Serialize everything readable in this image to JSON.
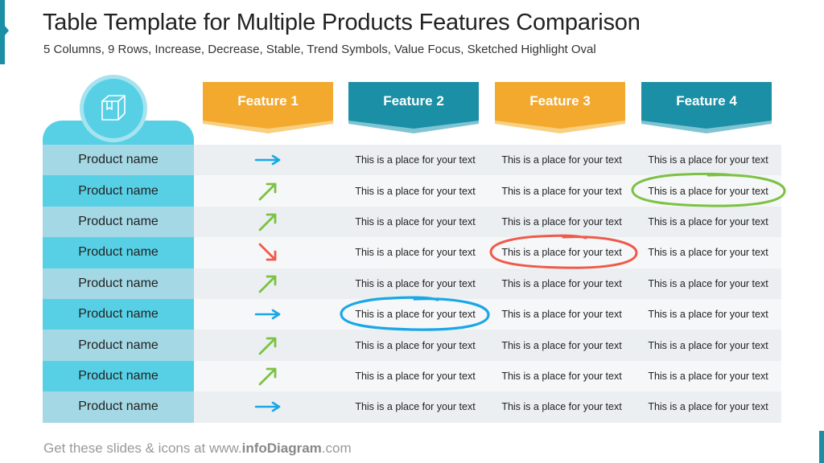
{
  "slide": {
    "title": "Table Template for Multiple Products Features Comparison",
    "subtitle": "5 Columns, 9 Rows, Increase, Decrease, Stable, Trend Symbols, Value Focus, Sketched Highlight Oval"
  },
  "header": {
    "product_icon": "box-icon",
    "features": [
      {
        "label": "Feature 1",
        "color": "#f2a92e"
      },
      {
        "label": "Feature 2",
        "color": "#1a8fa5"
      },
      {
        "label": "Feature 3",
        "color": "#f2a92e"
      },
      {
        "label": "Feature 4",
        "color": "#1a8fa5"
      }
    ]
  },
  "colors": {
    "increase": "#7cc242",
    "decrease": "#ef5a4a",
    "stable": "#1aa7e6",
    "product_light": "#a3d8e4",
    "product_dark": "#57d0e6",
    "row_light": "#eceff2",
    "row_dark": "#f6f7f9",
    "highlight_green": "#7cc242",
    "highlight_red": "#ef5a4a",
    "highlight_blue": "#1aa7e6"
  },
  "rows": [
    {
      "product": "Product name",
      "trend": "stable",
      "cells": [
        "This is a place for your text",
        "This is a place for your text",
        "This is a place for your text"
      ]
    },
    {
      "product": "Product name",
      "trend": "increase",
      "cells": [
        "This is a place for your text",
        "This is a place for your text",
        "This is a place for your text"
      ]
    },
    {
      "product": "Product name",
      "trend": "increase",
      "cells": [
        "This is a place for your text",
        "This is a place for your text",
        "This is a place for your text"
      ]
    },
    {
      "product": "Product name",
      "trend": "decrease",
      "cells": [
        "This is a place for your text",
        "This is a place for your text",
        "This is a place for your text"
      ]
    },
    {
      "product": "Product name",
      "trend": "increase",
      "cells": [
        "This is a place for your text",
        "This is a place for your text",
        "This is a place for your text"
      ]
    },
    {
      "product": "Product name",
      "trend": "stable",
      "cells": [
        "This is a place for your text",
        "This is a place for your text",
        "This is a place for your text"
      ]
    },
    {
      "product": "Product name",
      "trend": "increase",
      "cells": [
        "This is a place for your text",
        "This is a place for your text",
        "This is a place for your text"
      ]
    },
    {
      "product": "Product name",
      "trend": "increase",
      "cells": [
        "This is a place for your text",
        "This is a place for your text",
        "This is a place for your text"
      ]
    },
    {
      "product": "Product name",
      "trend": "stable",
      "cells": [
        "This is a place for your text",
        "This is a place for your text",
        "This is a place for your text"
      ]
    }
  ],
  "highlights": [
    {
      "row": 2,
      "column": "Feature 4",
      "color": "green"
    },
    {
      "row": 4,
      "column": "Feature 3",
      "color": "red"
    },
    {
      "row": 6,
      "column": "Feature 2",
      "color": "blue"
    }
  ],
  "footer": {
    "prefix": "Get these slides & icons at www.",
    "brand": "infoDiagram",
    "suffix": ".com"
  }
}
